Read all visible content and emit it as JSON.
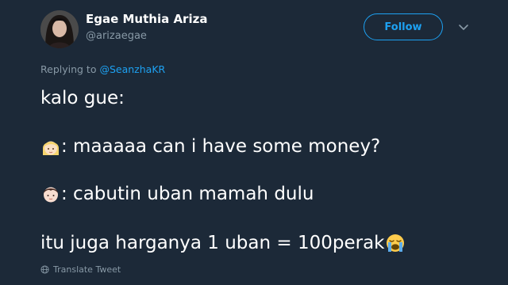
{
  "author": {
    "display_name": "Egae Muthia Ariza",
    "handle": "@arizaegae"
  },
  "header": {
    "follow_label": "Follow",
    "menu_icon": "chevron-down-icon"
  },
  "reply": {
    "prefix": "Replying to",
    "mention": "@SeanzhaKR"
  },
  "tweet": {
    "line_1": "kalo gue:",
    "line_2_emoji": "blond-girl-emoji",
    "line_2": ": maaaaa can i have some money?",
    "line_3_emoji": "woman-face-emoji",
    "line_3": ": cabutin uban mamah dulu",
    "line_4": "itu juga harganya 1 uban = 100perak",
    "line_4_emoji": "loudly-crying-face-emoji"
  },
  "footer": {
    "translate_label": "Translate Tweet",
    "translate_icon": "globe-icon"
  },
  "colors": {
    "background": "#1c2938",
    "accent": "#1da1f2",
    "secondary_text": "#8899a6",
    "primary_text": "#ffffff"
  }
}
